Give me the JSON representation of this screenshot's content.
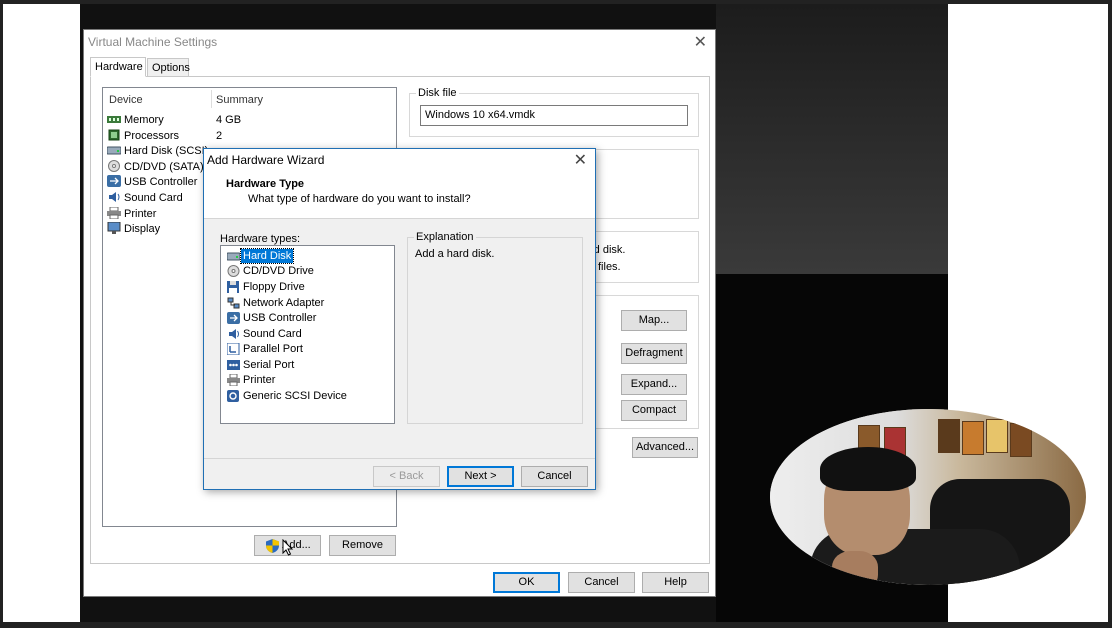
{
  "vm_settings": {
    "title": "Virtual Machine Settings",
    "tabs": [
      "Hardware",
      "Options"
    ],
    "device_header": "Device",
    "summary_header": "Summary",
    "devices": [
      {
        "name": "Memory",
        "summary": "4 GB",
        "icon": "memory-icon"
      },
      {
        "name": "Processors",
        "summary": "2",
        "icon": "processor-icon"
      },
      {
        "name": "Hard Disk (SCSI)",
        "summary": "",
        "icon": "hard-disk-icon"
      },
      {
        "name": "CD/DVD (SATA)",
        "summary": "",
        "icon": "cd-dvd-icon"
      },
      {
        "name": "USB Controller",
        "summary": "",
        "icon": "usb-icon"
      },
      {
        "name": "Sound Card",
        "summary": "",
        "icon": "sound-icon"
      },
      {
        "name": "Printer",
        "summary": "",
        "icon": "printer-icon"
      },
      {
        "name": "Display",
        "summary": "",
        "icon": "display-icon"
      }
    ],
    "disk_file_label": "Disk file",
    "disk_file_value": "Windows 10 x64.vmdk",
    "partial_text_1": "rd disk.",
    "partial_text_2": "files.",
    "buttons": {
      "map": "Map...",
      "defragment": "Defragment",
      "expand": "Expand...",
      "compact": "Compact",
      "advanced": "Advanced...",
      "add": "Add...",
      "remove": "Remove",
      "ok": "OK",
      "cancel": "Cancel",
      "help": "Help"
    }
  },
  "wizard": {
    "title": "Add Hardware Wizard",
    "heading": "Hardware Type",
    "subheading": "What type of hardware do you want to install?",
    "types_label": "Hardware types:",
    "types": [
      {
        "name": "Hard Disk",
        "icon": "hard-disk-icon",
        "selected": true
      },
      {
        "name": "CD/DVD Drive",
        "icon": "cd-dvd-icon",
        "selected": false
      },
      {
        "name": "Floppy Drive",
        "icon": "floppy-icon",
        "selected": false
      },
      {
        "name": "Network Adapter",
        "icon": "network-icon",
        "selected": false
      },
      {
        "name": "USB Controller",
        "icon": "usb-icon",
        "selected": false
      },
      {
        "name": "Sound Card",
        "icon": "sound-icon",
        "selected": false
      },
      {
        "name": "Parallel Port",
        "icon": "parallel-port-icon",
        "selected": false
      },
      {
        "name": "Serial Port",
        "icon": "serial-port-icon",
        "selected": false
      },
      {
        "name": "Printer",
        "icon": "printer-icon",
        "selected": false
      },
      {
        "name": "Generic SCSI Device",
        "icon": "scsi-icon",
        "selected": false
      }
    ],
    "explanation_label": "Explanation",
    "explanation_text": "Add a hard disk.",
    "buttons": {
      "back": "< Back",
      "next": "Next >",
      "cancel": "Cancel"
    }
  },
  "colors": {
    "selection": "#0078d7",
    "window_border": "#7a7a7a"
  }
}
